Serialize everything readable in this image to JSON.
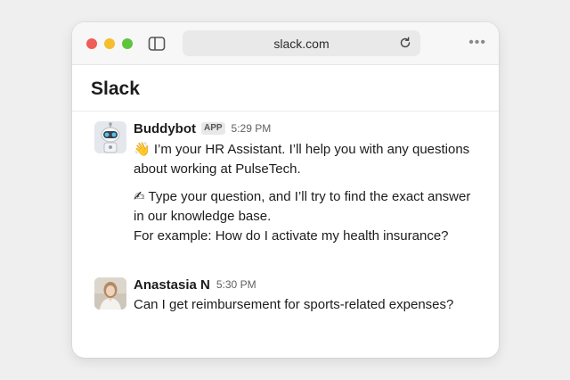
{
  "browser": {
    "url": "slack.com"
  },
  "app": {
    "title": "Slack"
  },
  "messages": [
    {
      "author": "Buddybot",
      "badge": "APP",
      "time": "5:29 PM",
      "avatar_icon": "robot-avatar",
      "paragraphs": [
        {
          "emoji": "👋",
          "text": "I’m your HR Assistant. I’ll help you with any questions about working at PulseTech."
        },
        {
          "emoji": "✍",
          "text": "Type your question, and I’ll try to find the exact answer in our knowledge base.",
          "text2": "For example: How do I activate my health insurance?"
        }
      ]
    },
    {
      "author": "Anastasia N",
      "time": "5:30 PM",
      "avatar_icon": "user-photo-avatar",
      "paragraphs": [
        {
          "text": "Can I get reimbursement for sports-related expenses?"
        }
      ]
    }
  ],
  "colors": {
    "traffic_red": "#ee5d57",
    "traffic_yellow": "#f5bd2f",
    "traffic_green": "#5ec43f"
  }
}
